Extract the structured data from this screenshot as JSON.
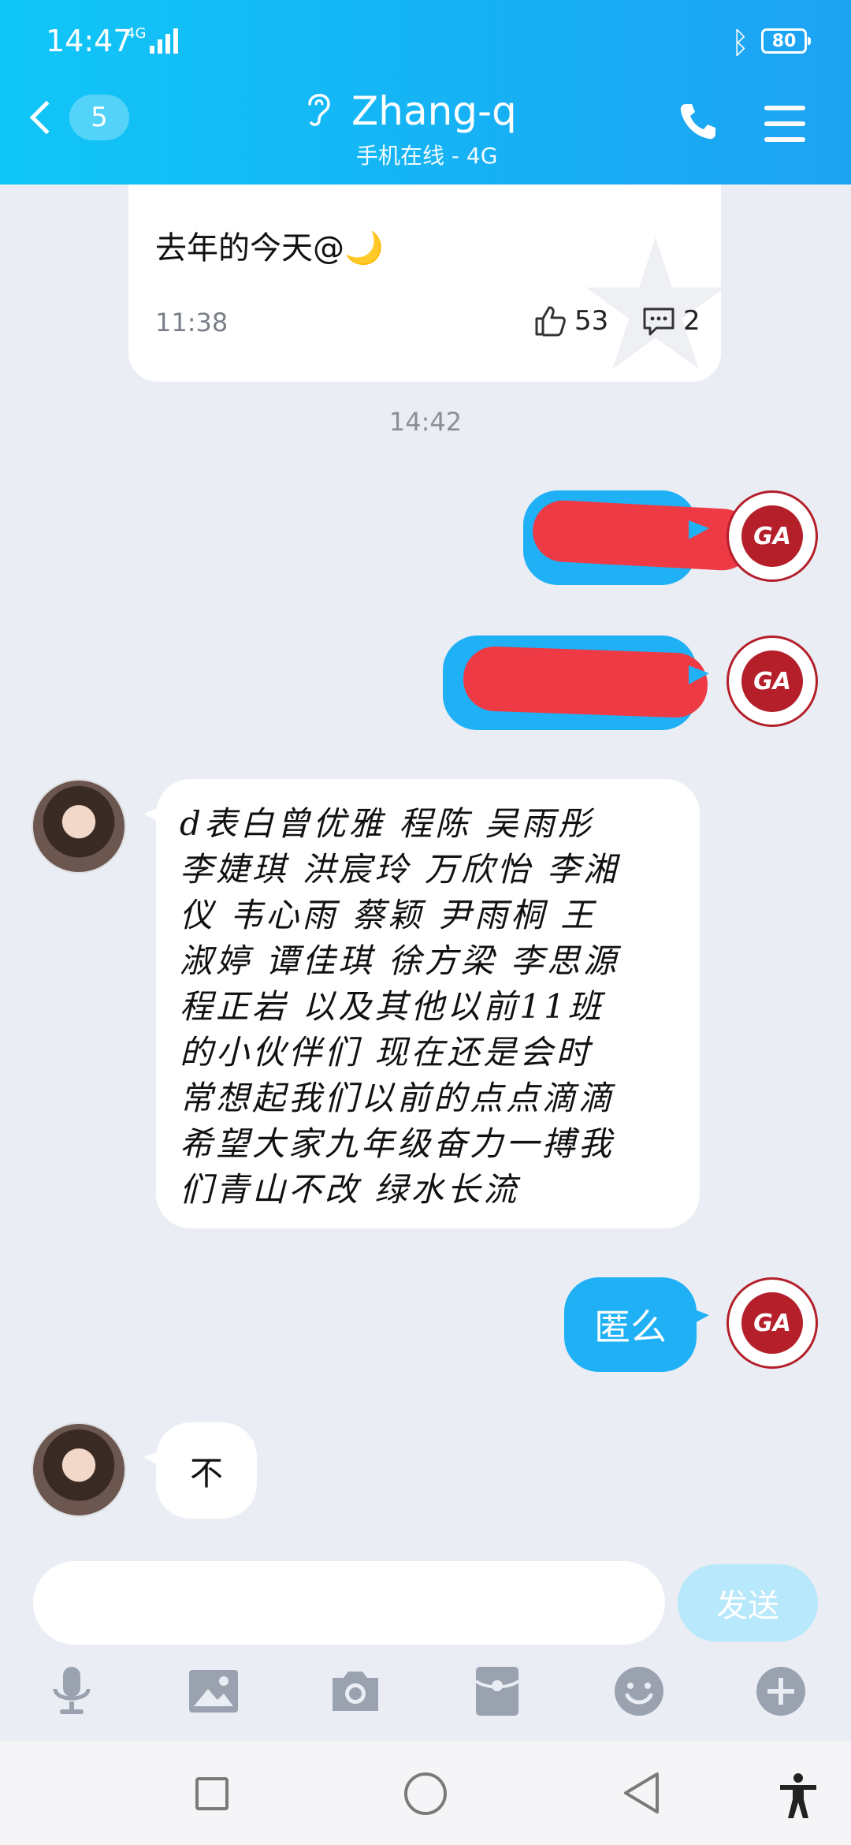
{
  "status_bar": {
    "time": "14:47",
    "network": "4G",
    "battery": "80"
  },
  "header": {
    "back_count": "5",
    "title": "Zhang-q",
    "subtitle": "手机在线 - 4G"
  },
  "shared_card": {
    "text": "去年的今天@🌙",
    "time": "11:38",
    "likes": "53",
    "comments": "2"
  },
  "timestamp": "14:42",
  "messages": [
    {
      "side": "out",
      "text": ""
    },
    {
      "side": "out",
      "text": ""
    },
    {
      "side": "in",
      "text": "d表白曾优雅 程陈 吴雨彤 李婕琪 洪宸玲 万欣怡 李湘仪 韦心雨 蔡颖 尹雨桐 王淑婷 谭佳琪 徐方梁 李思源 程正岩 以及其他以前11班的小伙伴们 现在还是会时常想起我们以前的点点滴滴希望大家九年级奋力一搏我们青山不改 绿水长流"
    },
    {
      "side": "out",
      "text": "匿么"
    },
    {
      "side": "in",
      "text": "不"
    }
  ],
  "long_lines": [
    "d表白曾优雅 程陈 吴雨彤",
    "李婕琪 洪宸玲 万欣怡 李湘",
    "仪 韦心雨 蔡颖 尹雨桐  王",
    "淑婷 谭佳琪 徐方梁 李思源",
    "程正岩 以及其他以前11班",
    "的小伙伴们 现在还是会时",
    "常想起我们以前的点点滴滴",
    "希望大家九年级奋力一搏我",
    "们青山不改 绿水长流"
  ],
  "input": {
    "send_label": "发送"
  },
  "logo_text": "GA",
  "colors": {
    "header": "#16b2f5",
    "bubble_out": "#1fb0f5",
    "bubble_in": "#ffffff",
    "background": "#eaedf4"
  }
}
